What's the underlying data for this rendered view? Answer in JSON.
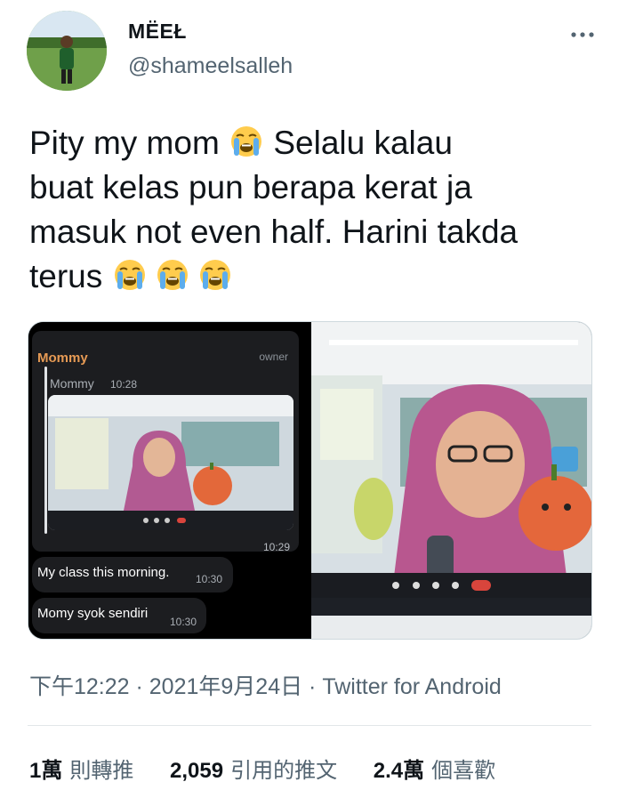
{
  "user": {
    "display_name": "MËEŁ",
    "handle": "@shameelsalleh",
    "more_icon": "ellipsis-icon"
  },
  "tweet": {
    "line1_a": "Pity my mom ",
    "line1_b": " Selalu kalau",
    "line2": "buat kelas pun berapa kerat ja",
    "line3": "masuk not even half. Harini takda",
    "line4": "terus ",
    "emoji_name": "loudly-crying-face"
  },
  "chat": {
    "sender": "Mommy",
    "role": "owner",
    "reply_name": "Mommy",
    "reply_time": "10:28",
    "image_time": "10:29",
    "messages": [
      {
        "text": "My class this morning.",
        "time": "10:30"
      },
      {
        "text": "Momy syok sendiri",
        "time": "10:30"
      }
    ]
  },
  "meta": {
    "timestamp": "下午12:22 · 2021年9月24日 · Twitter for Android"
  },
  "stats": [
    {
      "value": "1萬",
      "label": "則轉推"
    },
    {
      "value": "2,059",
      "label": "引用的推文"
    },
    {
      "value": "2.4萬",
      "label": "個喜歡"
    }
  ],
  "colors": {
    "text": "#0f1419",
    "secondary": "#536471",
    "chat_sender": "#e69a54",
    "chat_bg": "#1c1d20"
  }
}
